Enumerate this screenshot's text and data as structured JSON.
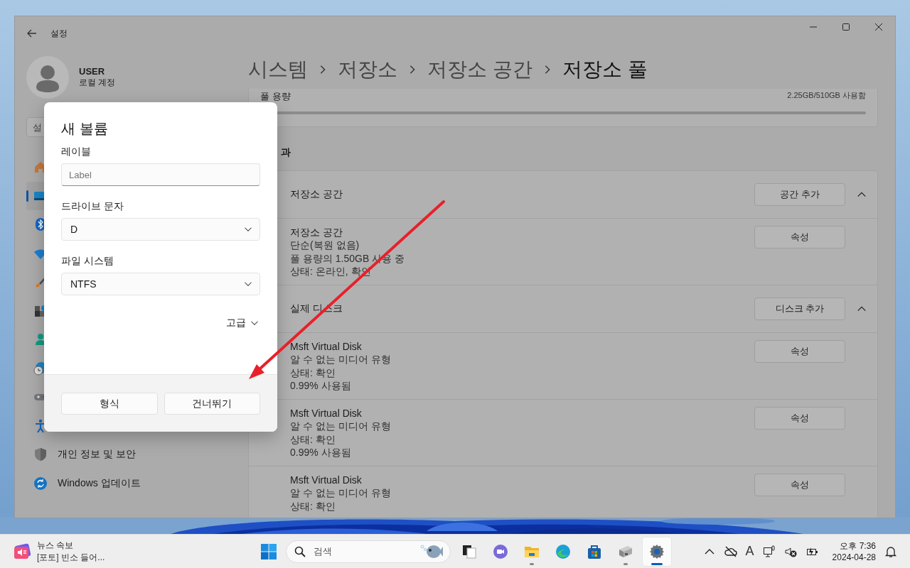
{
  "window": {
    "title": "설정"
  },
  "user": {
    "name": "USER",
    "account": "로컬 계정"
  },
  "search": {
    "placeholder": "설"
  },
  "sidebar": {
    "items": [
      {
        "selected": false
      },
      {
        "selected": true
      },
      {
        "selected": false
      },
      {
        "selected": false
      },
      {
        "selected": false
      },
      {
        "selected": false
      },
      {
        "selected": false
      },
      {
        "selected": false
      },
      {
        "selected": false
      },
      {
        "selected": false
      },
      {
        "label": "개인 정보 및 보안",
        "selected": false
      },
      {
        "label": "Windows 업데이트",
        "selected": false
      }
    ]
  },
  "breadcrumb": [
    "시스템",
    "저장소",
    "저장소 공간",
    "저장소 풀"
  ],
  "pool": {
    "label": "풀 용량",
    "usage": "2.25GB/510GB 사용함",
    "level": 0.0044
  },
  "section_heading": "과",
  "groups": [
    {
      "title": "저장소 공간",
      "button": "공간 추가",
      "expanded": true,
      "rows": [
        {
          "title": "저장소 공간",
          "lines": [
            "단순(복원 없음)",
            "풀 용량의 1.50GB 사용 중",
            "상태: 온라인, 확인"
          ],
          "button": "속성"
        }
      ]
    },
    {
      "title": "실제 디스크",
      "button": "디스크 추가",
      "expanded": true,
      "rows": [
        {
          "title": "Msft Virtual Disk",
          "lines": [
            "알 수 없는 미디어 유형",
            "상태: 확인",
            "0.99% 사용됨"
          ],
          "button": "속성"
        },
        {
          "title": "Msft Virtual Disk",
          "lines": [
            "알 수 없는 미디어 유형",
            "상태: 확인",
            "0.99% 사용됨"
          ],
          "button": "속성"
        },
        {
          "title": "Msft Virtual Disk",
          "lines": [
            "알 수 없는 미디어 유형",
            "상태: 확인"
          ],
          "button": "속성"
        }
      ]
    }
  ],
  "dialog": {
    "title": "새 볼륨",
    "fields": [
      {
        "label": "레이블",
        "kind": "text",
        "placeholder": "Label"
      },
      {
        "label": "드라이브 문자",
        "kind": "dropdown",
        "value": "D"
      },
      {
        "label": "파일 시스템",
        "kind": "dropdown",
        "value": "NTFS"
      }
    ],
    "advanced": {
      "label": "고급",
      "expanded": false
    },
    "buttons": [
      "형식",
      "건너뛰기"
    ]
  },
  "annotations": [
    {
      "kind": "arrow"
    }
  ],
  "taskbar": {
    "news": {
      "title": "뉴스 속보",
      "headline": "[포토] 빈소 들어..."
    },
    "search": {
      "placeholder": "검색"
    },
    "apps": [
      {
        "selected": false,
        "running": false
      },
      {
        "selected": false,
        "running": false
      },
      {
        "selected": false,
        "running": true
      },
      {
        "selected": false,
        "running": false
      },
      {
        "selected": false,
        "running": false
      },
      {
        "selected": false,
        "running": true
      },
      {
        "selected": true,
        "running": true
      }
    ],
    "tray": {
      "ime": "A"
    },
    "clock": {
      "time": "오후 7:36",
      "date": "2024-04-28"
    }
  }
}
